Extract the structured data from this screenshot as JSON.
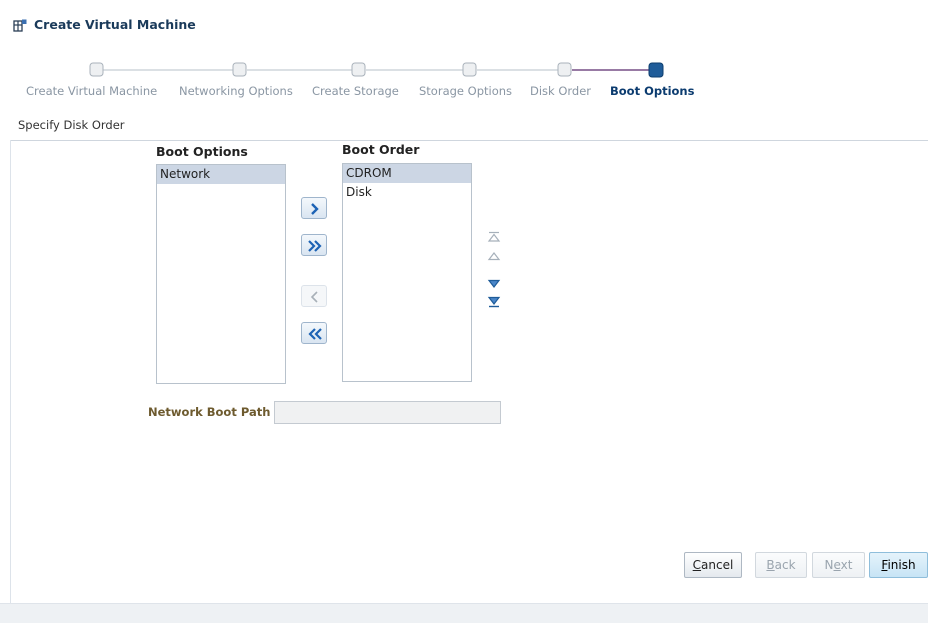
{
  "window": {
    "title": "Create Virtual Machine",
    "icon": "vm-icon"
  },
  "train": {
    "steps": [
      {
        "label": "Create Virtual Machine",
        "state": "visited"
      },
      {
        "label": "Networking Options",
        "state": "visited"
      },
      {
        "label": "Create Storage",
        "state": "visited"
      },
      {
        "label": "Storage Options",
        "state": "visited"
      },
      {
        "label": "Disk Order",
        "state": "visited"
      },
      {
        "label": "Boot Options",
        "state": "current"
      }
    ]
  },
  "page": {
    "subtitle": "Specify Disk Order"
  },
  "boot_options": {
    "title": "Boot Options",
    "items": [
      "Network"
    ],
    "selected": "Network"
  },
  "boot_order": {
    "title": "Boot Order",
    "items": [
      "CDROM",
      "Disk"
    ],
    "selected": "CDROM"
  },
  "shuttle": {
    "move_icon": "chevron-right-icon",
    "move_all_icon": "double-chevron-right-icon",
    "remove_icon": "chevron-left-icon",
    "remove_all_icon": "double-chevron-left-icon"
  },
  "reorder": {
    "top_icon": "move-to-top-icon",
    "up_icon": "move-up-icon",
    "down_icon": "move-down-icon",
    "bottom_icon": "move-to-bottom-icon"
  },
  "network_boot_path": {
    "label": "Network Boot Path",
    "value": ""
  },
  "buttons": {
    "cancel": {
      "mnemonic": "C",
      "rest": "ancel"
    },
    "back": {
      "mnemonic": "B",
      "rest": "ack"
    },
    "next": {
      "prefix": "N",
      "mnemonic": "e",
      "rest": "xt"
    },
    "finish": {
      "mnemonic": "F",
      "rest": "inish"
    }
  },
  "colors": {
    "accent": "#1f5c99",
    "train_active": "#5a2a6e",
    "label_gold": "#6d5a2e"
  }
}
